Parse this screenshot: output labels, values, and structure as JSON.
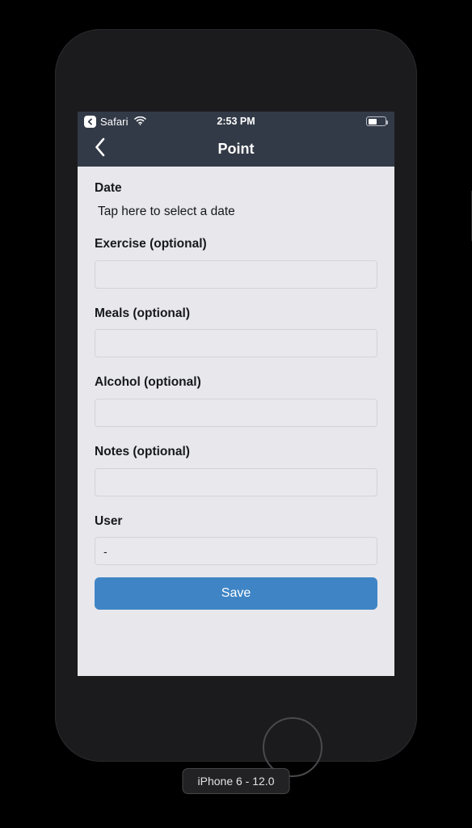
{
  "simulator": {
    "device_chip_label": "iPhone 6 - 12.0",
    "frame_color": "#1b1b1d",
    "screen_background": "#e8e8ec"
  },
  "status_bar": {
    "back_app_label": "Safari",
    "back_chip_icon": "chevron-left-icon",
    "wifi_icon": "wifi-icon",
    "time": "2:53 PM",
    "battery_icon": "battery-icon",
    "battery_level_percent": 45,
    "background_color": "#333a47",
    "text_color": "#ffffff"
  },
  "nav_bar": {
    "back_icon": "chevron-left-icon",
    "title": "Point",
    "background_color": "#333a47"
  },
  "form": {
    "fields": [
      {
        "name": "date",
        "label": "Date",
        "type": "tap-text",
        "value": "Tap here to select a date"
      },
      {
        "name": "exercise",
        "label": "Exercise (optional)",
        "type": "text",
        "value": "",
        "placeholder": ""
      },
      {
        "name": "meals",
        "label": "Meals (optional)",
        "type": "text",
        "value": "",
        "placeholder": ""
      },
      {
        "name": "alcohol",
        "label": "Alcohol (optional)",
        "type": "text",
        "value": "",
        "placeholder": ""
      },
      {
        "name": "notes",
        "label": "Notes (optional)",
        "type": "text",
        "value": "",
        "placeholder": ""
      },
      {
        "name": "user",
        "label": "User",
        "type": "text",
        "value": "-",
        "placeholder": ""
      }
    ],
    "save_label": "Save",
    "save_color": "#3f85c6",
    "input_background": "#e9e9ed",
    "input_border": "#d2d2d8",
    "label_color": "#16181c"
  }
}
